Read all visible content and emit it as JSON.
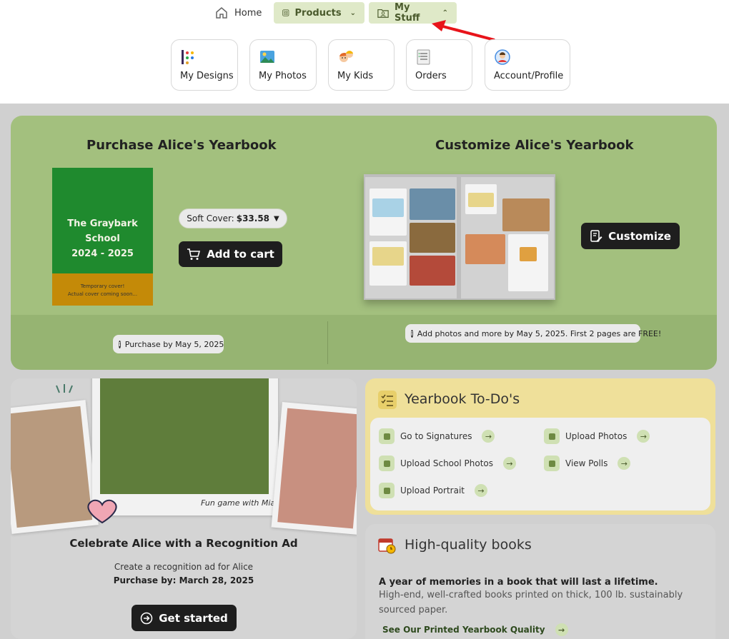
{
  "nav": {
    "home": "Home",
    "products": "Products",
    "my_stuff": "My Stuff",
    "cards": [
      {
        "label": "My Designs",
        "icon": "designs-icon"
      },
      {
        "label": "My Photos",
        "icon": "photos-icon"
      },
      {
        "label": "My Kids",
        "icon": "kids-icon"
      },
      {
        "label": "Orders",
        "icon": "orders-icon"
      },
      {
        "label": "Account/Profile",
        "icon": "profile-icon"
      }
    ]
  },
  "purchase": {
    "title": "Purchase Alice's Yearbook",
    "cover_title_1": "The Graybark School",
    "cover_title_2": "2024 - 2025",
    "cover_note_1": "Temporary cover!",
    "cover_note_2": "Actual cover coming soon...",
    "cover_option": "Soft Cover:",
    "cover_price": "$33.58",
    "add_to_cart": "Add to cart",
    "deadline": "Purchase by May 5, 2025"
  },
  "customize": {
    "title": "Customize Alice's Yearbook",
    "button": "Customize",
    "note": "Add photos and more by May 5, 2025. First 2 pages are FREE!"
  },
  "recognition": {
    "caption": "Fun game with Mia",
    "title": "Celebrate Alice with a Recognition Ad",
    "subtitle": "Create a recognition ad for Alice",
    "purchase_by": "Purchase by: March 28, 2025",
    "cta": "Get started"
  },
  "todos": {
    "title": "Yearbook To-Do's",
    "items": [
      {
        "label": "Go to Signatures"
      },
      {
        "label": "Upload Photos"
      },
      {
        "label": "Upload School Photos"
      },
      {
        "label": "View Polls"
      },
      {
        "label": "Upload Portrait"
      }
    ]
  },
  "quality": {
    "title": "High-quality books",
    "headline": "A year of memories in a book that will last a lifetime.",
    "body": "High-end, well-crafted books printed on thick, 100 lb. sustainably sourced paper.",
    "link": "See Our Printed Yearbook Quality"
  },
  "colors": {
    "accent_green": "#a3c07e",
    "pill_green": "#dfe9c8",
    "todo_yellow": "#efe09a",
    "dark_button": "#1e1e1e",
    "annotation_red": "#e8141a"
  }
}
